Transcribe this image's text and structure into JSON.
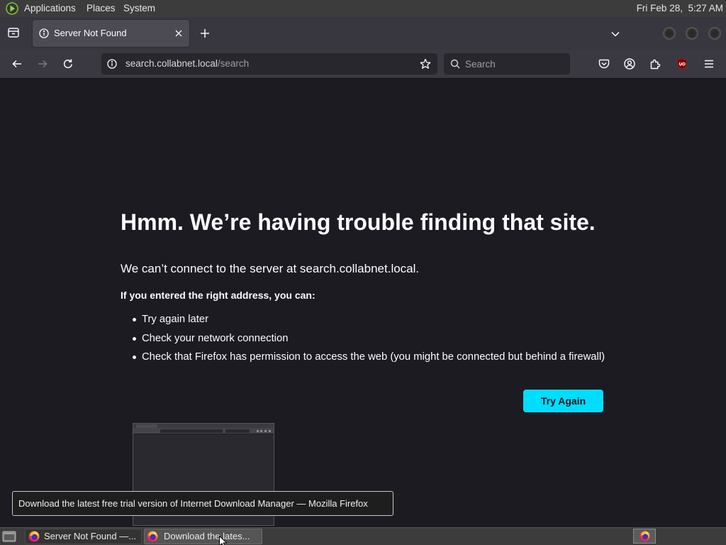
{
  "top_panel": {
    "logo_icon": "distro-logo-icon",
    "menus": {
      "applications": "Applications",
      "places": "Places",
      "system": "System"
    },
    "clock": "Fri Feb 28,  5:27 AM"
  },
  "browser": {
    "tab_overview_icon": "tab-overview-icon",
    "tabs": [
      {
        "title": "Server Not Found",
        "icon": "info-icon",
        "close_icon": "close-icon",
        "active": true
      }
    ],
    "new_tab_icon": "plus-icon",
    "list_all_tabs_icon": "chevron-down-icon",
    "window_control_icons": [
      "minimize-icon",
      "maximize-icon",
      "close-window-icon"
    ],
    "navigation": {
      "back_icon": "back-arrow-icon",
      "forward_icon": "forward-arrow-icon",
      "forward_enabled": false,
      "reload_icon": "reload-icon"
    },
    "url_bar": {
      "site_info_icon": "info-icon",
      "domain": "search.collabnet.local",
      "path": "/search",
      "bookmark_icon": "star-icon"
    },
    "search_bar": {
      "icon": "search-icon",
      "placeholder": "Search"
    },
    "toolbar_icons": [
      "pocket-icon",
      "account-icon",
      "extensions-icon",
      "ublock-origin-icon",
      "hamburger-menu-icon"
    ]
  },
  "error_page": {
    "title": "Hmm. We’re having trouble finding that site.",
    "description": "We can’t connect to the server at search.collabnet.local.",
    "suggestions_heading": "If you entered the right address, you can:",
    "suggestions": [
      "Try again later",
      "Check your network connection",
      "Check that Firefox has permission to access the web (you might be connected but behind a firewall)"
    ],
    "try_again_label": "Try Again"
  },
  "tooltip": {
    "text": "Download the latest free trial version of Internet Download Manager — Mozilla Firefox"
  },
  "taskbar": {
    "show_desktop_icon": "show-desktop-icon",
    "tasks": [
      {
        "label": "Server Not Found —...",
        "icon": "firefox-icon",
        "active": false
      },
      {
        "label": "Download the lates...",
        "icon": "firefox-icon",
        "active": true
      }
    ],
    "workspace_icon": "firefox-icon"
  },
  "colors": {
    "page_background": "#1c1b22",
    "page_text": "#fbfbfe",
    "try_again_button": "#00ddff",
    "try_again_text": "#15141a",
    "toolbar": "#3a3941",
    "desktop_panel": "#3c3c3c"
  }
}
